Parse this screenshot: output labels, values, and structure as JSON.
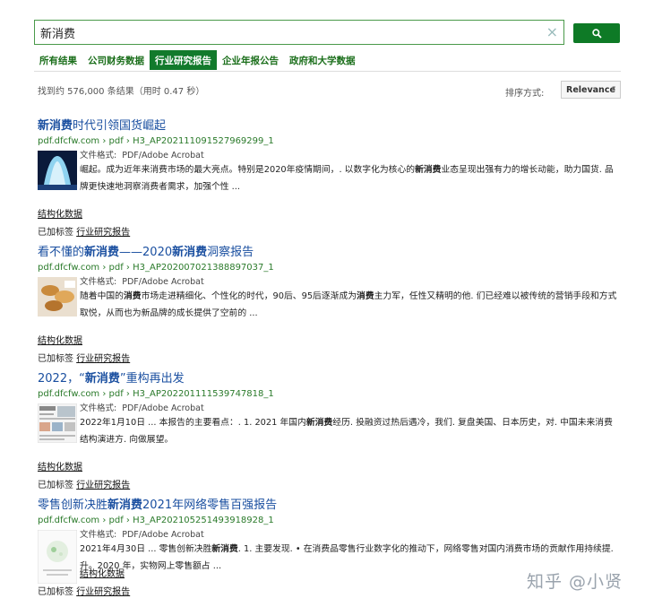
{
  "search": {
    "query": "新消费",
    "clear_icon": "×",
    "button_icon": "search-icon"
  },
  "tabs": [
    {
      "label": "所有结果"
    },
    {
      "label": "公司财务数据"
    },
    {
      "label": "行业研究报告"
    },
    {
      "label": "企业年报公告"
    },
    {
      "label": "政府和大学数据"
    }
  ],
  "stats": "找到约 576,000 条结果（用时 0.47 秒）",
  "sort": {
    "label": "排序方式:",
    "value": "Relevance"
  },
  "format_label": "文件格式:",
  "structured_label": "结构化数据",
  "tag_prefix": "已加标签",
  "tag_name": "行业研究报告",
  "results": [
    {
      "title_parts": [
        [
          "新消费",
          true
        ],
        [
          "时代引领国货崛起",
          false
        ]
      ],
      "url": "pdf.dfcfw.com › pdf › H3_AP202111091527969299_1",
      "format": "PDF/Adobe Acrobat",
      "snippet_parts": [
        [
          "崛起。成为近年来消费市场的最大亮点。特别是2020年疫情期间，. 以数字化为核心的",
          false
        ],
        [
          "新消费",
          true
        ],
        [
          "业态呈现出强有力的增长动能，助力国货. 品牌更快速地洞察消费者需求，加强个性 ...",
          false
        ]
      ]
    },
    {
      "title_parts": [
        [
          "看不懂的",
          false
        ],
        [
          "新消费",
          true
        ],
        [
          "——2020",
          false
        ],
        [
          "新消费",
          true
        ],
        [
          "洞察报告",
          false
        ]
      ],
      "url": "pdf.dfcfw.com › pdf › H3_AP202007021388897037_1",
      "format": "PDF/Adobe Acrobat",
      "snippet_parts": [
        [
          "随着中国的",
          false
        ],
        [
          "消费",
          true
        ],
        [
          "市场走进精细化、个性化的时代，90后、95后逐渐成为",
          false
        ],
        [
          "消费",
          true
        ],
        [
          "主力军，任性又精明的他. 们已经难以被传统的营销手段和方式取悦，从而也为新品牌的成长提供了空前的 ...",
          false
        ]
      ]
    },
    {
      "title_parts": [
        [
          "2022，“",
          false
        ],
        [
          "新消费",
          true
        ],
        [
          "”重构再出发",
          false
        ]
      ],
      "url": "pdf.dfcfw.com › pdf › H3_AP202201111539747818_1",
      "format": "PDF/Adobe Acrobat",
      "snippet_parts": [
        [
          "2022年1月10日 ... 本报告的主要看点：. 1. 2021 年国内",
          false
        ],
        [
          "新消费",
          true
        ],
        [
          "经历. 投融资过热后遇冷，我们. 复盘美国、日本历史，对. 中国未来消费结构演进方. 向做展望。",
          false
        ]
      ]
    },
    {
      "title_parts": [
        [
          "零售创新决胜",
          false
        ],
        [
          "新消费",
          true
        ],
        [
          "2021年网络零售百强报告",
          false
        ]
      ],
      "url": "pdf.dfcfw.com › pdf › H3_AP202105251493918928_1",
      "format": "PDF/Adobe Acrobat",
      "snippet_parts": [
        [
          "2021年4月30日 ... 零售创新决胜",
          false
        ],
        [
          "新消费",
          true
        ],
        [
          ". 1. 主要发现. • 在消费品零售行业数字化的推动下，网络零售对国内消费市场的贡献作用持续提. 升。2020 年，实物网上零售额占 ...",
          false
        ]
      ]
    }
  ],
  "watermark": "知乎 @小贤",
  "colors": {
    "accent_green": "#127a2c",
    "link_blue": "#1a4fa0",
    "url_green": "#2a7a2a"
  }
}
